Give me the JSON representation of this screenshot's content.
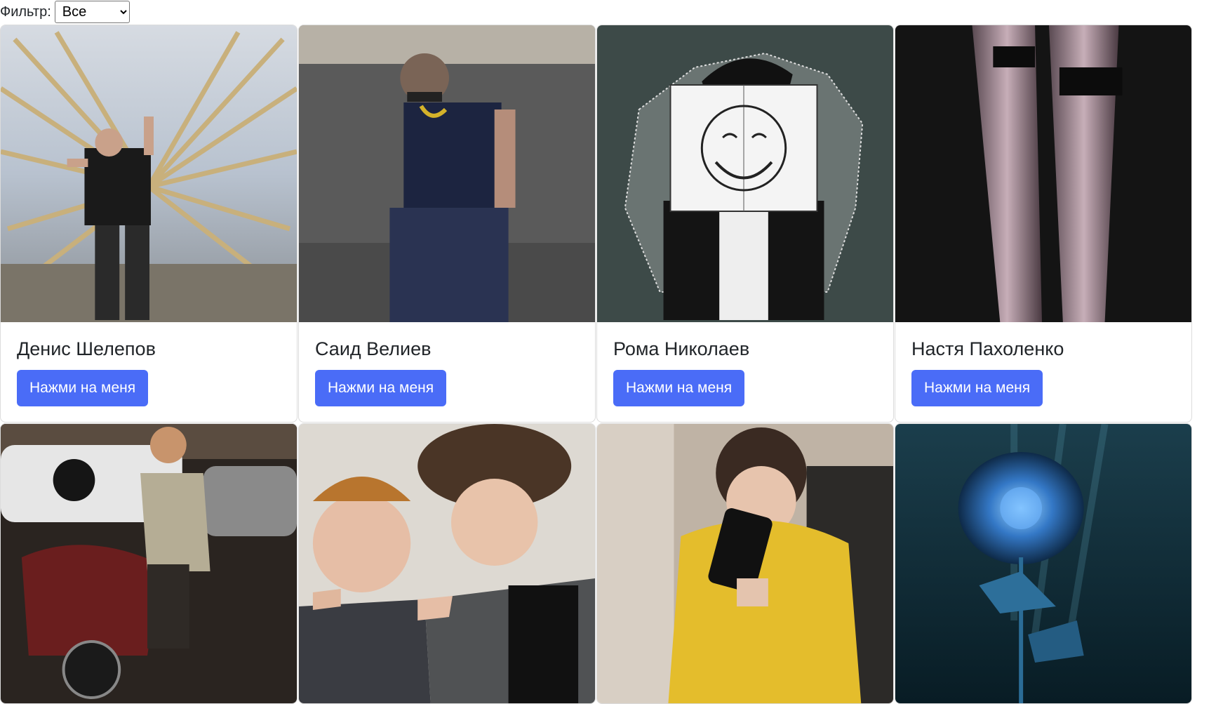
{
  "filter": {
    "label": "Фильтр:",
    "selected": "Все"
  },
  "cards": [
    {
      "name": "Денис Шелепов",
      "button": "Нажми на меня",
      "image": "person-with-wings-photo"
    },
    {
      "name": "Саид Велиев",
      "button": "Нажми на меня",
      "image": "person-on-sofa-photo"
    },
    {
      "name": "Рома Николаев",
      "button": "Нажми на меня",
      "image": "anime-drawing-image"
    },
    {
      "name": "Настя Пахоленко",
      "button": "Нажми на меня",
      "image": "abstract-legs-painting"
    },
    {
      "image": "person-on-motorcycle-photo"
    },
    {
      "image": "two-people-pointing-photo"
    },
    {
      "image": "mirror-selfie-photo"
    },
    {
      "image": "blue-rose-art-image"
    }
  ]
}
